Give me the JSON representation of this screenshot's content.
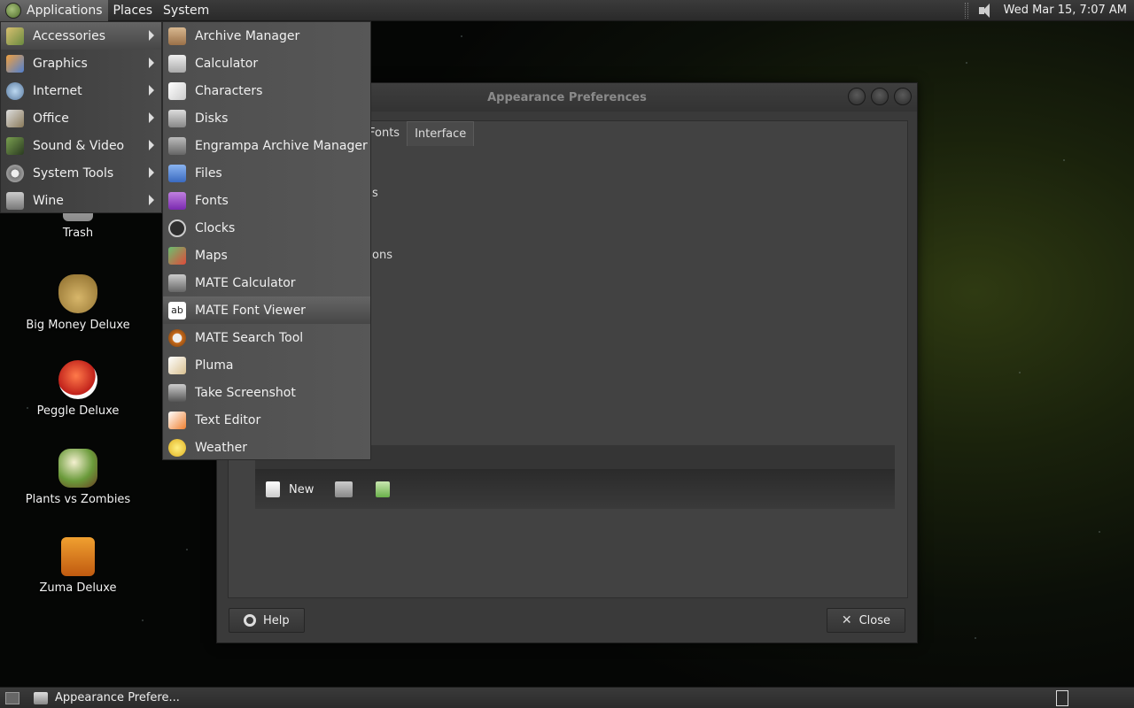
{
  "top_panel": {
    "menus": [
      "Applications",
      "Places",
      "System"
    ],
    "clock": "Wed Mar 15,  7:07 AM",
    "icons": {
      "logo": "mate-logo-icon",
      "volume": "volume-icon"
    }
  },
  "desktop_icons": [
    {
      "label": "Trash",
      "icon": "trash-icon"
    },
    {
      "label": "Big Money Deluxe",
      "icon": "money-bag-icon"
    },
    {
      "label": "Peggle Deluxe",
      "icon": "peggle-icon"
    },
    {
      "label": "Plants vs Zombies",
      "icon": "plants-icon"
    },
    {
      "label": "Zuma Deluxe",
      "icon": "zuma-icon"
    }
  ],
  "window": {
    "title": "Appearance Preferences",
    "tabs": [
      "Fonts",
      "Interface"
    ],
    "partial_texts": [
      "s",
      "ons"
    ],
    "toolbar": {
      "new_label": "New"
    },
    "help_label": "Help",
    "close_label": "Close"
  },
  "applications_menu": {
    "categories": [
      {
        "label": "Accessories",
        "icon": "accessories-icon"
      },
      {
        "label": "Graphics",
        "icon": "graphics-icon"
      },
      {
        "label": "Internet",
        "icon": "internet-icon"
      },
      {
        "label": "Office",
        "icon": "office-icon"
      },
      {
        "label": "Sound & Video",
        "icon": "sound-video-icon"
      },
      {
        "label": "System Tools",
        "icon": "system-tools-icon"
      },
      {
        "label": "Wine",
        "icon": "wine-icon"
      }
    ],
    "accessories": [
      {
        "label": "Archive Manager",
        "icon": "archive-icon"
      },
      {
        "label": "Calculator",
        "icon": "calculator-icon"
      },
      {
        "label": "Characters",
        "icon": "characters-icon"
      },
      {
        "label": "Disks",
        "icon": "disks-icon"
      },
      {
        "label": "Engrampa Archive Manager",
        "icon": "engrampa-icon"
      },
      {
        "label": "Files",
        "icon": "files-icon"
      },
      {
        "label": "Fonts",
        "icon": "fonts-icon"
      },
      {
        "label": "Clocks",
        "icon": "clocks-icon"
      },
      {
        "label": "Maps",
        "icon": "maps-icon"
      },
      {
        "label": "MATE Calculator",
        "icon": "mate-calculator-icon"
      },
      {
        "label": "MATE Font Viewer",
        "icon": "font-viewer-icon"
      },
      {
        "label": "MATE Search Tool",
        "icon": "search-tool-icon"
      },
      {
        "label": "Pluma",
        "icon": "pluma-icon"
      },
      {
        "label": "Take Screenshot",
        "icon": "screenshot-icon"
      },
      {
        "label": "Text Editor",
        "icon": "text-editor-icon"
      },
      {
        "label": "Weather",
        "icon": "weather-icon"
      }
    ]
  },
  "bottom_panel": {
    "task_label": "Appearance Prefere..."
  }
}
